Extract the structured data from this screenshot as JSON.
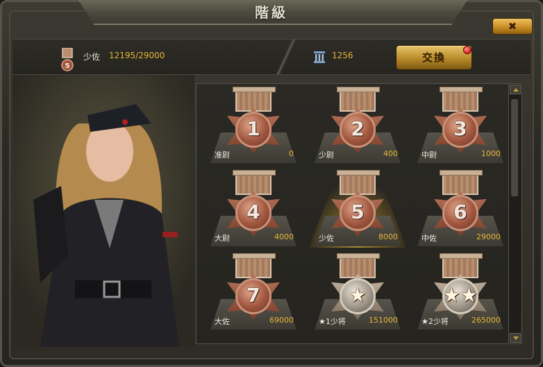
{
  "window": {
    "title": "階級",
    "close_label": "✖"
  },
  "header": {
    "rank_badge_number": "5",
    "rank_name": "少佐",
    "rank_progress": "12195/29000",
    "coin_value": "1256",
    "exchange_label": "交換"
  },
  "ranks": [
    {
      "num": "1",
      "name": "准尉",
      "req": "0",
      "kind": "bronze"
    },
    {
      "num": "2",
      "name": "少尉",
      "req": "400",
      "kind": "bronze"
    },
    {
      "num": "3",
      "name": "中尉",
      "req": "1000",
      "kind": "bronze"
    },
    {
      "num": "4",
      "name": "大尉",
      "req": "4000",
      "kind": "bronze"
    },
    {
      "num": "5",
      "name": "少佐",
      "req": "8000",
      "kind": "bronze",
      "selected": true
    },
    {
      "num": "6",
      "name": "中佐",
      "req": "29000",
      "kind": "bronze"
    },
    {
      "num": "7",
      "name": "大佐",
      "req": "69000",
      "kind": "bronze"
    },
    {
      "num": "★",
      "name": "★1少将",
      "req": "151000",
      "kind": "silver"
    },
    {
      "num": "★★",
      "name": "★2少将",
      "req": "265000",
      "kind": "silver"
    }
  ],
  "colors": {
    "accent_gold": "#e8b53a",
    "selected_glow": "#f0c83c"
  }
}
